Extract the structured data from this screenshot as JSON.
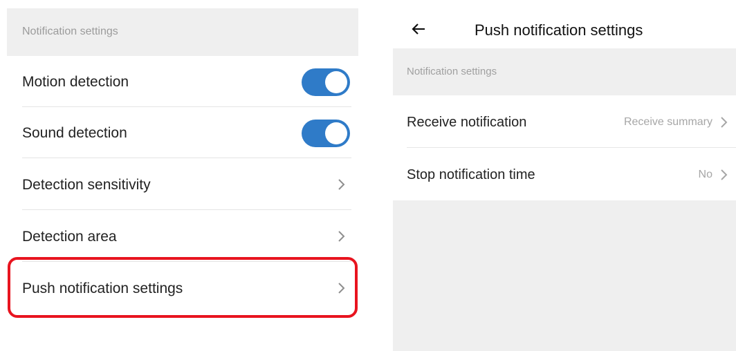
{
  "left": {
    "section_header": "Notification settings",
    "rows": [
      {
        "label": "Motion detection",
        "control": "toggle",
        "on": true
      },
      {
        "label": "Sound detection",
        "control": "toggle",
        "on": true
      },
      {
        "label": "Detection sensitivity",
        "control": "chevron-right-icon"
      },
      {
        "label": "Detection area",
        "control": "chevron-right-icon"
      },
      {
        "label": "Push notification settings",
        "control": "chevron-right-icon",
        "highlighted": true
      }
    ]
  },
  "right": {
    "back_icon": "back-arrow-icon",
    "title": "Push notification settings",
    "section_header": "Notification settings",
    "rows": [
      {
        "label": "Receive notification",
        "value": "Receive summary"
      },
      {
        "label": "Stop notification time",
        "value": "No"
      }
    ]
  },
  "colors": {
    "toggle_on": "#2f7bc8",
    "highlight_border": "#e8141f",
    "section_bg": "#efefef"
  }
}
